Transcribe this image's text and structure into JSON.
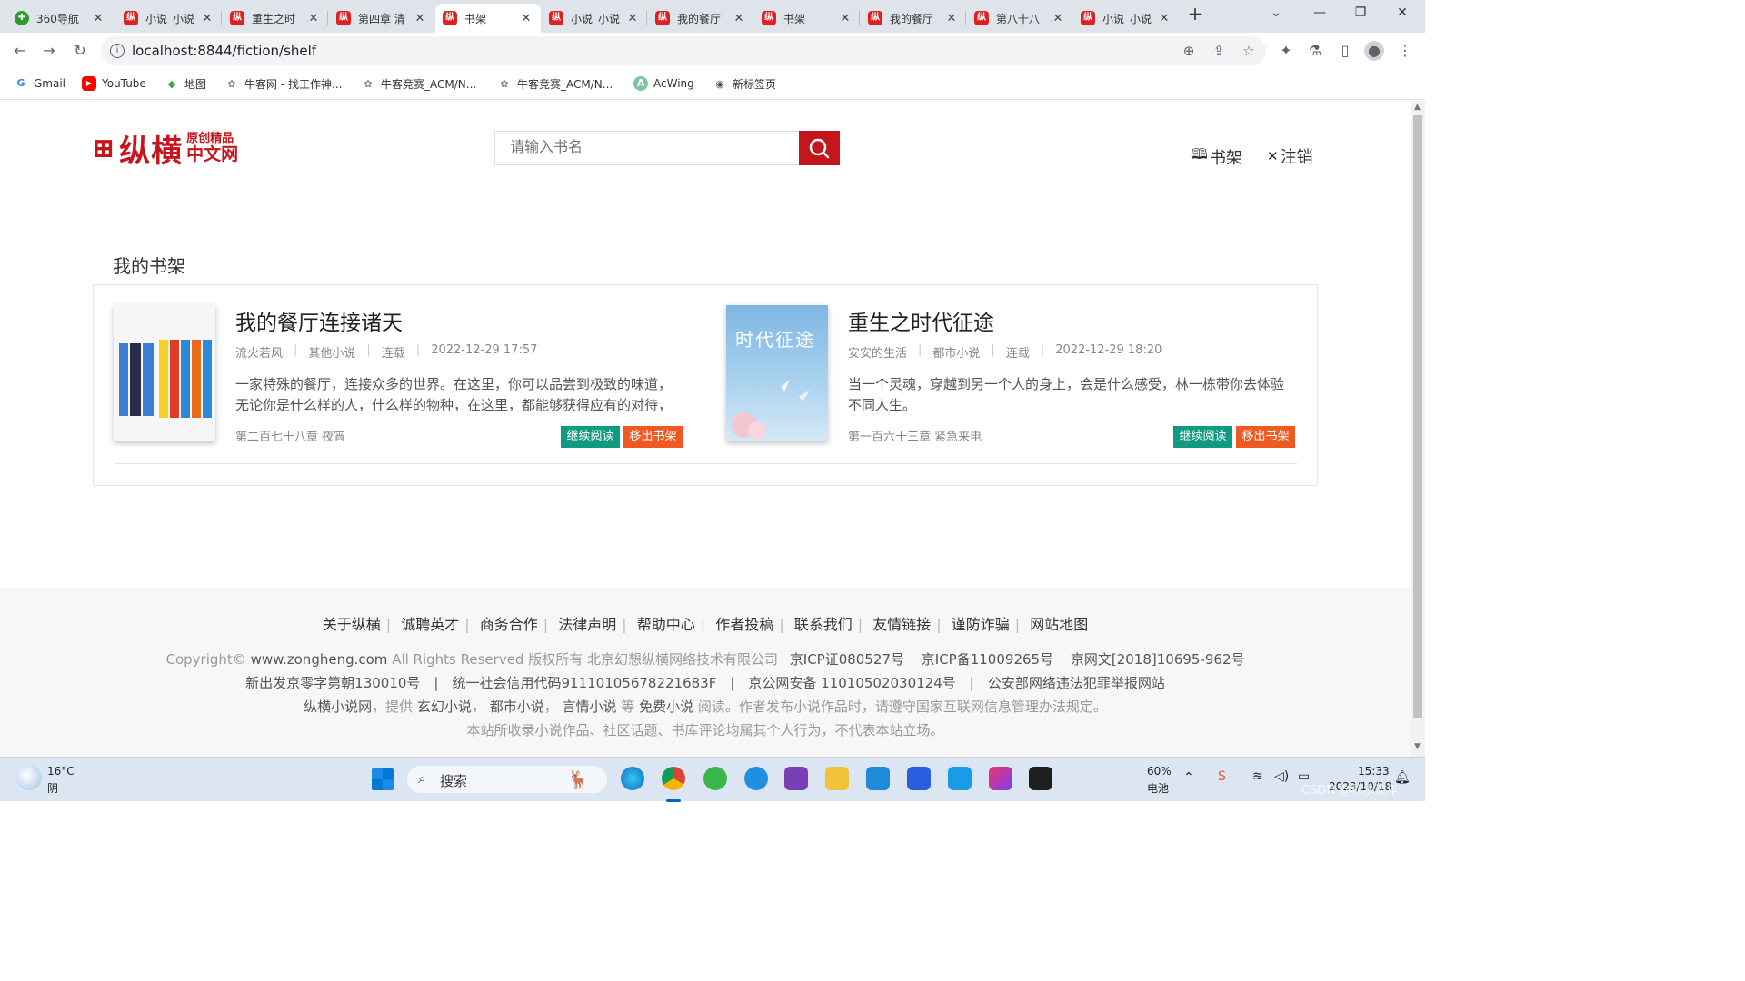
{
  "browser": {
    "tabs": [
      {
        "title": "360导航",
        "icon": "globe-icon"
      },
      {
        "title": "小说_小说",
        "icon": "zongheng-icon"
      },
      {
        "title": "重生之时",
        "icon": "zongheng-icon"
      },
      {
        "title": "第四章 清",
        "icon": "zongheng-icon"
      },
      {
        "title": "书架",
        "icon": "zongheng-icon"
      },
      {
        "title": "小说_小说",
        "icon": "zongheng-icon"
      },
      {
        "title": "我的餐厅",
        "icon": "zongheng-icon"
      },
      {
        "title": "书架",
        "icon": "zongheng-icon"
      },
      {
        "title": "我的餐厅",
        "icon": "zongheng-icon"
      },
      {
        "title": "第八十八",
        "icon": "zongheng-icon"
      },
      {
        "title": "小说_小说",
        "icon": "zongheng-icon"
      }
    ],
    "active_tab_index": 4,
    "url": "localhost:8844/fiction/shelf",
    "bookmarks": [
      {
        "label": "Gmail",
        "icon": "G"
      },
      {
        "label": "YouTube",
        "icon": "▶"
      },
      {
        "label": "地图",
        "icon": "◆"
      },
      {
        "label": "牛客网 - 找工作神...",
        "icon": "✿"
      },
      {
        "label": "牛客竞赛_ACM/N...",
        "icon": "✿"
      },
      {
        "label": "牛客竞赛_ACM/N...",
        "icon": "✿"
      },
      {
        "label": "AcWing",
        "icon": "A"
      },
      {
        "label": "新标签页",
        "icon": "◉"
      }
    ]
  },
  "site": {
    "logo_main": "纵横",
    "logo_top": "原创精品",
    "logo_bottom": "中文网",
    "search_placeholder": "请输入书名",
    "nav_shelf": "书架",
    "nav_logout": "注销"
  },
  "shelf": {
    "title": "我的书架",
    "read_button": "继续阅读",
    "remove_button": "移出书架",
    "books": [
      {
        "title": "我的餐厅连接诸天",
        "author": "流火若风",
        "category": "其他小说",
        "status": "连载",
        "updated": "2022-12-29 17:57",
        "intro": "一家特殊的餐厅，连接众多的世界。在这里，你可以品尝到极致的味道，无论你是什么样的人，什么样的物种，在这里，都能够获得应有的对待，品...",
        "latest_chapter": "第二百七十八章 夜宵"
      },
      {
        "title": "重生之时代征途",
        "author": "安安的生活",
        "category": "都市小说",
        "status": "连载",
        "updated": "2022-12-29 18:20",
        "intro": "当一个灵魂，穿越到另一个人的身上，会是什么感受，林一栋带你去体验不同人生。",
        "latest_chapter": "第一百六十三章 紧急来电",
        "cover_text": "时代征途"
      }
    ]
  },
  "footer": {
    "links": [
      "关于纵横",
      "诚聘英才",
      "商务合作",
      "法律声明",
      "帮助中心",
      "作者投稿",
      "联系我们",
      "友情链接",
      "谨防诈骗",
      "网站地图"
    ],
    "copyright_prefix": "Copyright©",
    "copyright_domain": "www.zongheng.com",
    "copyright_rest": "All Rights Reserved 版权所有 北京幻想纵横网络技术有限公司",
    "icp1": "京ICP证080527号",
    "icp2": "京ICP备11009265号",
    "icp3": "京网文[2018]10695-962号",
    "license_line": "新出发京零字第朝130010号　|　统一社会信用代码91110105678221683F　|　京公网安备 11010502030124号　|　公安部网络违法犯罪举报网站",
    "desc_a": "纵横小说网",
    "desc_b": "，提供",
    "desc_c": "玄幻小说",
    "desc_d": "，",
    "desc_e": "都市小说",
    "desc_f": "，",
    "desc_g": "言情小说",
    "desc_h": "等",
    "desc_i": "免费小说",
    "desc_j": "阅读。作者发布小说作品时，请遵守国家互联网信息管理办法规定。",
    "disclaimer": "本站所收录小说作品、社区话题、书库评论均属其个人行为，不代表本站立场。"
  },
  "taskbar": {
    "weather_temp": "16°C",
    "weather_desc": "阴",
    "search_label": "搜索",
    "battery_pct": "60%",
    "battery_label": "电池",
    "time": "15:33",
    "date": "2023/10/18",
    "watermark": "CSDN @秋水流年"
  },
  "colors": {
    "brand_red": "#c4161c",
    "read_green": "#119a82",
    "remove_orange": "#ef5a23"
  }
}
